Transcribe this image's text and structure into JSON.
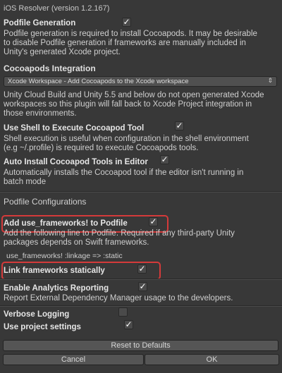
{
  "window": {
    "title": "iOS Resolver (version 1.2.167)"
  },
  "podfile_generation": {
    "label": "Podfile Generation",
    "checked": true,
    "description": [
      "Podfile generation is required to install Cocoapods.  It may be desirable",
      "to disable Podfile generation if frameworks are manually included in",
      "Unity's generated Xcode project."
    ]
  },
  "cocoapods_integration": {
    "heading": "Cocoapods Integration",
    "dropdown_value": "Xcode Workspace - Add Cocoapods to the Xcode workspace",
    "description": [
      "Unity Cloud Build and Unity 5.5 and below do not open generated Xcode",
      "workspaces so this plugin will fall back to Xcode Project integration in",
      "those environments."
    ]
  },
  "use_shell": {
    "label": "Use Shell to Execute Cocoapod Tool",
    "checked": true,
    "description": [
      "Shell execution is useful when configuration in the shell environment",
      "(e.g ~/.profile) is required to execute Cocoapods tools."
    ]
  },
  "auto_install": {
    "label": "Auto Install Cocoapod Tools in Editor",
    "checked": true,
    "description": [
      "Automatically installs the Cocoapod tool if the editor isn't running in",
      "batch mode"
    ]
  },
  "podfile_configurations": {
    "heading": "Podfile Configurations"
  },
  "use_frameworks": {
    "label": "Add use_frameworks! to Podfile",
    "checked": true,
    "description": [
      "Add the following line to Podfile. Required if any third-party Unity",
      "packages depends on Swift frameworks."
    ],
    "code": "use_frameworks! :linkage => :static"
  },
  "link_statically": {
    "label": "Link frameworks statically",
    "checked": true
  },
  "analytics": {
    "label": "Enable Analytics Reporting",
    "checked": true,
    "description": "Report External Dependency Manager usage to the developers."
  },
  "verbose_logging": {
    "label": "Verbose Logging",
    "checked": false
  },
  "project_settings": {
    "label": "Use project settings",
    "checked": true
  },
  "buttons": {
    "reset": "Reset to Defaults",
    "cancel": "Cancel",
    "ok": "OK"
  },
  "icons": {
    "check": "✓",
    "dropdown_arrow": "⇕"
  },
  "colors": {
    "highlight": "#d43a3a",
    "background": "#383838"
  }
}
